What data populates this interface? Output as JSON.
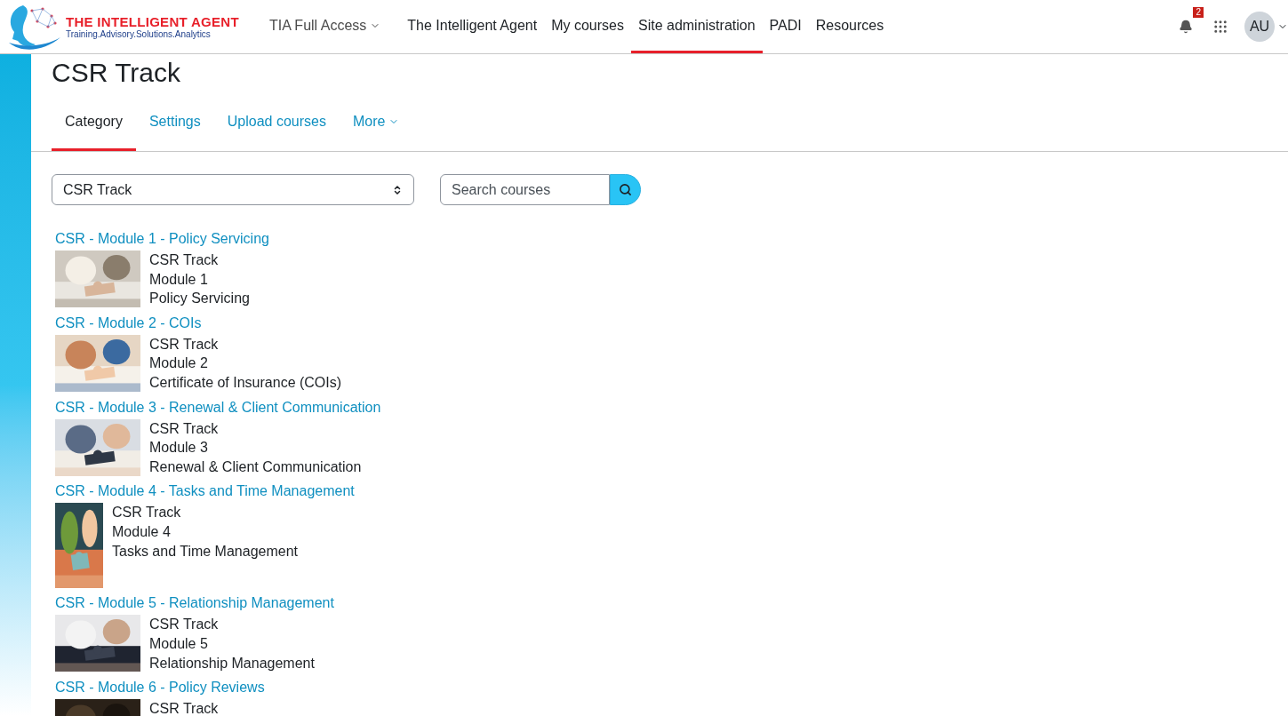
{
  "brand": {
    "name": "THE INTELLIGENT AGENT",
    "tagline": "Training.Advisory.Solutions.Analytics"
  },
  "nav": [
    {
      "label": "TIA Full Access",
      "dropdown": true,
      "selected": false
    },
    {
      "label": "The Intelligent Agent",
      "dropdown": false,
      "selected": false
    },
    {
      "label": "My courses",
      "dropdown": false,
      "selected": false
    },
    {
      "label": "Site administration",
      "dropdown": false,
      "selected": true
    },
    {
      "label": "PADI",
      "dropdown": false,
      "selected": false
    },
    {
      "label": "Resources",
      "dropdown": false,
      "selected": false
    }
  ],
  "notifications": {
    "count": "2"
  },
  "user": {
    "initials": "AU"
  },
  "page_title": "CSR Track",
  "tabs": [
    {
      "label": "Category",
      "selected": true,
      "dropdown": false
    },
    {
      "label": "Settings",
      "selected": false,
      "dropdown": false
    },
    {
      "label": "Upload courses",
      "selected": false,
      "dropdown": false
    },
    {
      "label": "More",
      "selected": false,
      "dropdown": true
    }
  ],
  "category_select": {
    "value": "CSR Track"
  },
  "search": {
    "placeholder": "Search courses"
  },
  "courses": [
    {
      "title": "CSR - Module 1 - Policy Servicing",
      "kind": "wide",
      "summary": [
        "CSR Track",
        "Module 1",
        "Policy Servicing"
      ]
    },
    {
      "title": "CSR - Module 2 - COIs",
      "kind": "wide",
      "summary": [
        "CSR Track",
        "Module 2",
        "Certificate of Insurance (COIs)"
      ]
    },
    {
      "title": "CSR - Module 3 - Renewal & Client Communication",
      "kind": "wide",
      "summary": [
        "CSR Track",
        "Module 3",
        "Renewal & Client Communication"
      ]
    },
    {
      "title": "CSR - Module 4 - Tasks and Time Management",
      "kind": "tall",
      "summary": [
        "CSR Track",
        "Module 4",
        "Tasks and Time Management"
      ]
    },
    {
      "title": "CSR - Module 5 - Relationship Management",
      "kind": "wide",
      "summary": [
        "CSR Track",
        "Module 5",
        "Relationship Management"
      ]
    },
    {
      "title": "CSR - Module 6 - Policy Reviews",
      "kind": "wide",
      "summary": [
        "CSR Track"
      ]
    }
  ]
}
